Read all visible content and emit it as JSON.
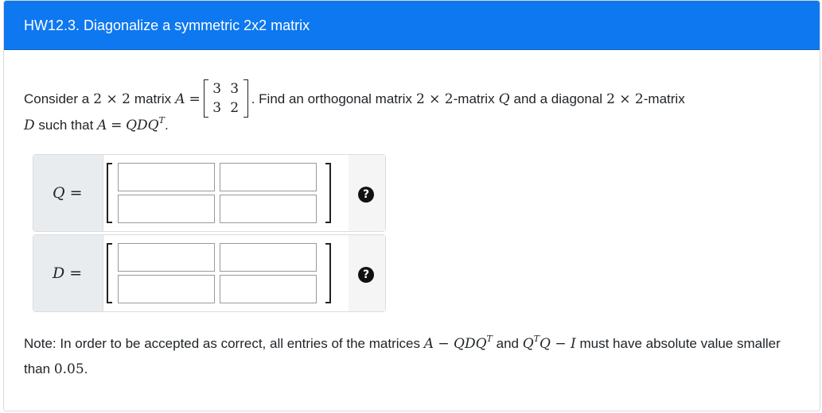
{
  "header": {
    "title": "HW12.3. Diagonalize a symmetric 2x2 matrix"
  },
  "question": {
    "consider": "Consider a",
    "dim": "2 × 2",
    "matrix_word": "matrix",
    "A_label": "A",
    "eq": "=",
    "matrix_A": [
      "3",
      "3",
      "3",
      "2"
    ],
    "find_text": ". Find an orthogonal matrix",
    "dim2": "2 × 2",
    "matrix_Q_text": "-matrix",
    "Q": "Q",
    "and_text": "and a diagonal",
    "dim3": "2 × 2",
    "matrix_D_text": "-matrix",
    "D": "D",
    "such_that": "such that",
    "equation_lhs": "A",
    "equation_rhs": "QDQ",
    "T": "T",
    "period": "."
  },
  "answers": {
    "Q_label": "Q",
    "D_label": "D",
    "eq": "=",
    "Q_values": [
      "",
      "",
      "",
      ""
    ],
    "D_values": [
      "",
      "",
      "",
      ""
    ],
    "help_glyph": "?"
  },
  "note": {
    "prefix": "Note: In order to be accepted as correct, all entries of the matrices",
    "expr1": "A − QDQ",
    "T": "T",
    "and": "and",
    "expr2a": "Q",
    "expr2b": "Q − I",
    "suffix": "must have absolute value smaller than",
    "tolerance": "0.05",
    "period": "."
  },
  "colors": {
    "header_bg": "#0d78f0",
    "label_bg": "#e9ecef"
  }
}
